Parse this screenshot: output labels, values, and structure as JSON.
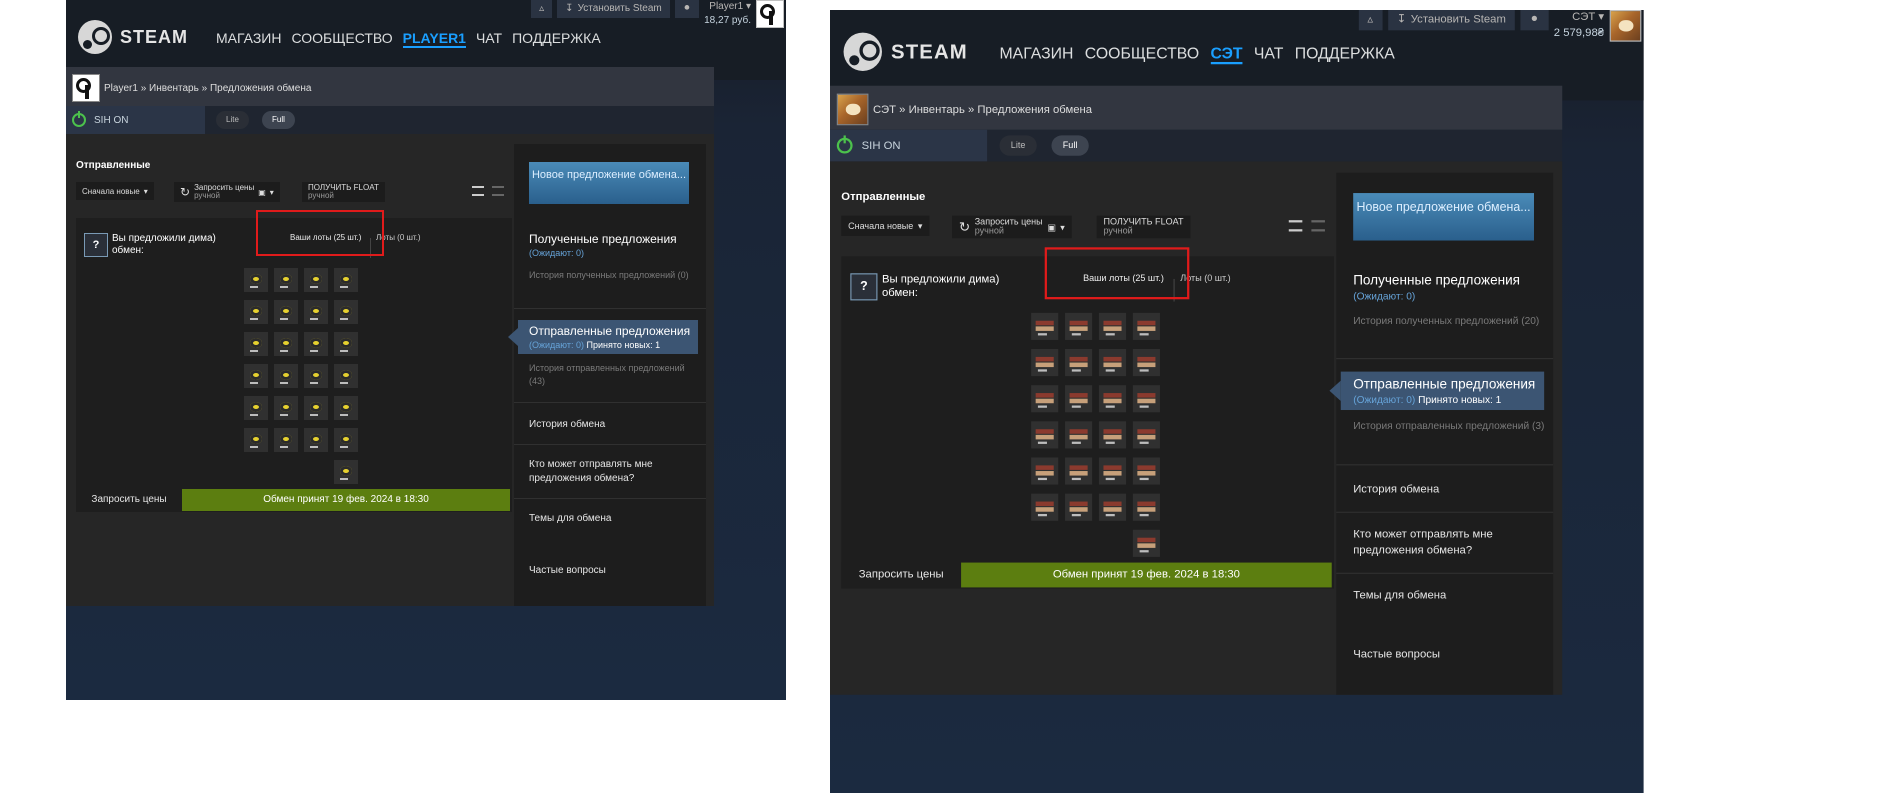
{
  "left": {
    "nav": [
      "МАГАЗИН",
      "СООБЩЕСТВО",
      "PLAYER1",
      "ЧАТ",
      "ПОДДЕРЖКА"
    ],
    "active_nav": "PLAYER1",
    "topbar": {
      "install": "Установить Steam",
      "account": "Player1",
      "balance": "18,27 руб."
    },
    "breadcrumb": {
      "user": "Player1",
      "sep1": "»",
      "inventory": "Инвентарь",
      "sep2": "»",
      "page": "Предложения обмена"
    },
    "item_style": "a"
  },
  "right": {
    "nav": [
      "МАГАЗИН",
      "СООБЩЕСТВО",
      "СЭТ",
      "ЧАТ",
      "ПОДДЕРЖКА"
    ],
    "active_nav": "СЭТ",
    "topbar": {
      "install": "Установить Steam",
      "account": "СЭТ",
      "balance": "2 579,98₴"
    },
    "breadcrumb": {
      "user": "СЭТ",
      "sep1": "»",
      "inventory": "Инвентарь",
      "sep2": "»",
      "page": "Предложения обмена"
    },
    "item_style": "b"
  },
  "common": {
    "logo_text": "STEAM",
    "sih": {
      "label": "SIH ON",
      "lite": "Lite",
      "full": "Full"
    },
    "section_title": "Отправленные",
    "controls": {
      "sort": "Сначала новые",
      "request_prices": "Запросить цены",
      "request_prices_sub": "ручной",
      "get_float": "ПОЛУЧИТЬ FLOAT",
      "get_float_sub": "ручной"
    },
    "offer": {
      "text": "Вы предложили дима) обмен:",
      "your_items": "Ваши лоты (25 шт.)",
      "their_items": "Лоты (0 шт.)",
      "request_prices_btn": "Запросить цены",
      "accepted": "Обмен принят 19 фев. 2024 в 18:30",
      "item_count": 25
    },
    "sidebar": {
      "new_offer": "Новое предложение обмена...",
      "received_title": "Полученные предложения",
      "received_waiting": "(Ожидают: 0)",
      "sent_title": "Отправленные предложения",
      "sent_waiting": "(Ожидают: 0)",
      "sent_new": "Принято новых: 1",
      "trade_history": "История обмена",
      "who_can_send": "Кто может отправлять мне предложения обмена?",
      "trade_topics": "Темы для обмена",
      "faq": "Частые вопросы"
    }
  },
  "left_history": {
    "received": "История полученных предложений (0)",
    "sent": "История отправленных предложений (43)"
  },
  "right_history": {
    "received": "История полученных предложений (20)",
    "sent": "История отправленных предложений (3)"
  }
}
